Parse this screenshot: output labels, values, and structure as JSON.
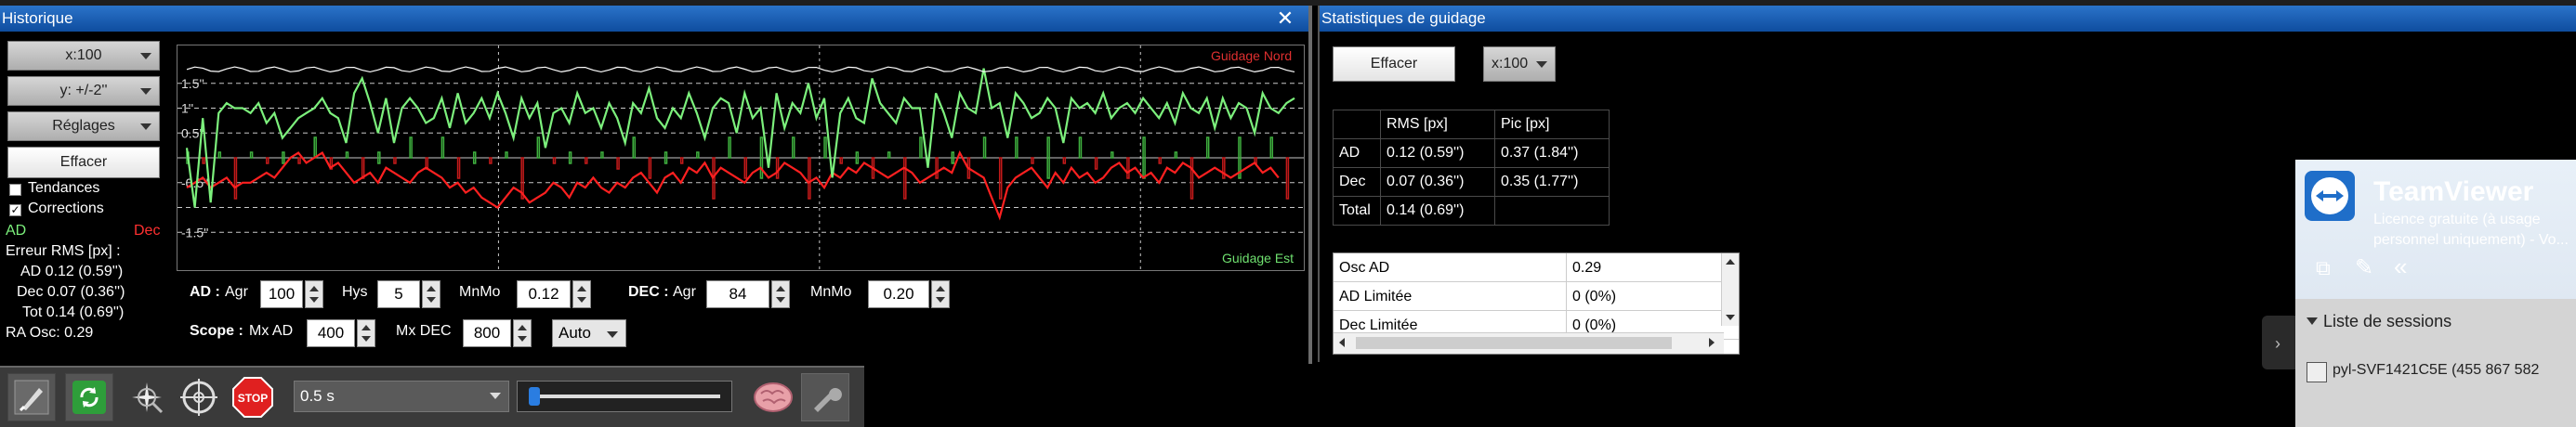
{
  "historique": {
    "title": "Historique",
    "close": "✕",
    "x_scale": "x:100",
    "y_scale": "y: +/-2''",
    "settings": "Réglages",
    "clear": "Effacer",
    "trends": "Tendances",
    "corrections": "Corrections",
    "ad": "AD",
    "dec": "Dec",
    "rms_title": "Erreur RMS [px] :",
    "rms_ad": "AD  0.12 (0.59'')",
    "rms_dec": "Dec  0.07 (0.36'')",
    "rms_tot": "Tot  0.14 (0.69'')",
    "ra_osc": "RA Osc: 0.29",
    "chart": {
      "labels": {
        "north": "Guidage Nord",
        "east": "Guidage Est"
      },
      "y_ticks": [
        "1.5''",
        "1''",
        "0.5''",
        "-0.5''",
        "-1.5''"
      ],
      "colors": {
        "ra": "#7cf07c",
        "dec": "#ff2020",
        "bars_ra": "#3fb03f",
        "bars_dec": "#c41a1a",
        "snr": "#ffffff",
        "grid": "#c8c8c8"
      },
      "chart_data": {
        "type": "line",
        "ylim": [
          -2,
          2
        ],
        "series": [
          {
            "values": [
              0.2,
              -1.0,
              0.8,
              -0.9,
              0.9,
              1.1,
              1.0,
              1.0,
              0.9,
              1.1,
              0.7,
              0.9,
              0.4,
              0.6,
              0.8,
              0.9,
              1.0,
              1.2,
              0.9,
              0.8,
              0.3,
              1.3,
              1.6,
              1.1,
              0.5,
              1.2,
              0.3,
              1.0,
              1.2,
              1.0,
              0.7,
              0.8,
              1.2,
              0.6,
              1.3,
              0.7,
              0.9,
              1.2,
              0.8,
              1.3,
              0.9,
              0.4,
              1.2,
              0.8,
              1.1,
              0.2,
              0.9,
              1.0,
              0.7,
              1.3,
              0.9,
              1.0,
              0.6,
              1.1,
              0.8,
              0.3,
              1.1,
              0.9,
              1.4,
              0.8,
              0.6,
              1.0,
              0.8,
              1.3,
              0.9,
              0.4,
              1.0,
              1.2,
              1.1,
              0.5,
              1.3,
              0.8,
              1.0,
              -0.2,
              1.3,
              0.6,
              1.1,
              0.9,
              1.5,
              0.8,
              1.2,
              -0.4,
              0.9,
              1.2,
              0.8,
              0.7,
              1.6,
              1.1,
              0.9,
              0.7,
              1.2,
              1.0,
              1.0,
              -0.2,
              1.3,
              0.9,
              0.4,
              1.3,
              1.0,
              0.9,
              1.8,
              1.0,
              1.1,
              0.4,
              1.3,
              1.1,
              0.8,
              0.9,
              1.2,
              1.0,
              0.3,
              1.2,
              1.0,
              1.1,
              0.9,
              1.3,
              0.8,
              1.0,
              1.1,
              0.9,
              1.2,
              1.0,
              0.8,
              1.1,
              0.7,
              1.3,
              1.0,
              0.9,
              1.2,
              0.6,
              1.2,
              0.8,
              1.1,
              1.0,
              0.5,
              1.3,
              1.0,
              0.9,
              1.1,
              1.2
            ]
          },
          {
            "values": [
              -0.6,
              -0.5,
              -0.4,
              -0.6,
              -0.5,
              -0.4,
              -0.6,
              -0.5,
              -0.5,
              -0.4,
              -0.3,
              -0.4,
              -0.2,
              0.0,
              0.1,
              -0.1,
              0.0,
              0.1,
              -0.2,
              -0.1,
              -0.3,
              -0.5,
              -0.4,
              -0.3,
              -0.5,
              -0.2,
              -0.3,
              -0.4,
              -0.5,
              -0.3,
              -0.2,
              -0.3,
              -0.4,
              -0.6,
              -0.5,
              -0.7,
              -0.6,
              -0.8,
              -0.9,
              -1.0,
              -0.8,
              -0.6,
              -0.7,
              -0.9,
              -0.8,
              -0.7,
              -0.5,
              -0.6,
              -0.8,
              -0.5,
              -0.6,
              -0.4,
              -0.6,
              -0.7,
              -0.5,
              -0.6,
              -0.4,
              -0.3,
              -0.5,
              -0.7,
              -0.4,
              -0.3,
              -0.5,
              -0.2,
              -0.3,
              -0.1,
              -0.4,
              -0.2,
              -0.3,
              -0.4,
              -0.5,
              -0.3,
              -0.2,
              -0.4,
              -0.3,
              -0.1,
              -0.2,
              -0.3,
              -0.5,
              -0.4,
              -0.6,
              -0.3,
              -0.4,
              -0.2,
              -0.3,
              -0.1,
              -0.2,
              -0.3,
              -0.4,
              -0.3,
              -0.2,
              -0.3,
              -0.5,
              -0.4,
              -0.3,
              -0.2,
              -0.3,
              0.1,
              -0.2,
              -0.3,
              -0.4,
              -0.8,
              -1.2,
              -0.6,
              -0.4,
              -0.3,
              -0.2,
              -0.4,
              -0.6,
              -0.3,
              -0.5,
              -0.2,
              -0.4,
              -0.3,
              -0.5,
              -0.4,
              -0.2,
              -0.1,
              -0.3,
              -0.2,
              -0.4,
              -0.3,
              -0.5,
              -0.2,
              -0.3,
              -0.1,
              -0.2,
              -0.4,
              -0.3,
              -0.2,
              -0.3,
              -0.4,
              -0.3,
              -0.2,
              -0.1,
              -0.3,
              -0.2,
              -0.4
            ]
          }
        ]
      }
    },
    "ad_label": "AD :",
    "ad_agr_label": "Agr",
    "ad_agr": "100",
    "hys_label": "Hys",
    "hys": "5",
    "mnmo_label": "MnMo",
    "mnmo": "0.12",
    "dec_label": "DEC :",
    "dec_agr_label": "Agr",
    "dec_agr": "84",
    "dec_mnmo_label": "MnMo",
    "dec_mnmo": "0.20",
    "scope_label": "Scope :",
    "mx_ad_label": "Mx AD",
    "mx_ad": "400",
    "mx_dec_label": "Mx DEC",
    "mx_dec": "800",
    "mode": "Auto"
  },
  "toolbar": {
    "exposure": "0.5 s",
    "buttons": [
      "connect-icon",
      "loop-icon",
      "star-select-icon",
      "crosshair-icon",
      "stop-icon"
    ],
    "stop": "STOP"
  },
  "stats": {
    "title": "Statistiques de guidage",
    "clear": "Effacer",
    "x_scale": "x:100",
    "headers": [
      "",
      "RMS [px]",
      "Pic [px]"
    ],
    "rows": [
      [
        "AD",
        "0.12 (0.59'')",
        "0.37 (1.84'')"
      ],
      [
        "Dec",
        "0.07 (0.36'')",
        "0.35 (1.77'')"
      ],
      [
        "Total",
        "0.14 (0.69'')",
        ""
      ]
    ],
    "details": [
      [
        "Osc AD",
        "0.29"
      ],
      [
        "AD Limitée",
        "0 (0%)"
      ],
      [
        "Dec Limitée",
        "0 (0%)"
      ]
    ]
  },
  "teamviewer": {
    "brand": "TeamViewer",
    "license": "Licence gratuite (à usage personnel uniquement) - Vo...",
    "sessions": "Liste de sessions",
    "session_item": "pyl-SVF1421C5E (455 867 582"
  }
}
